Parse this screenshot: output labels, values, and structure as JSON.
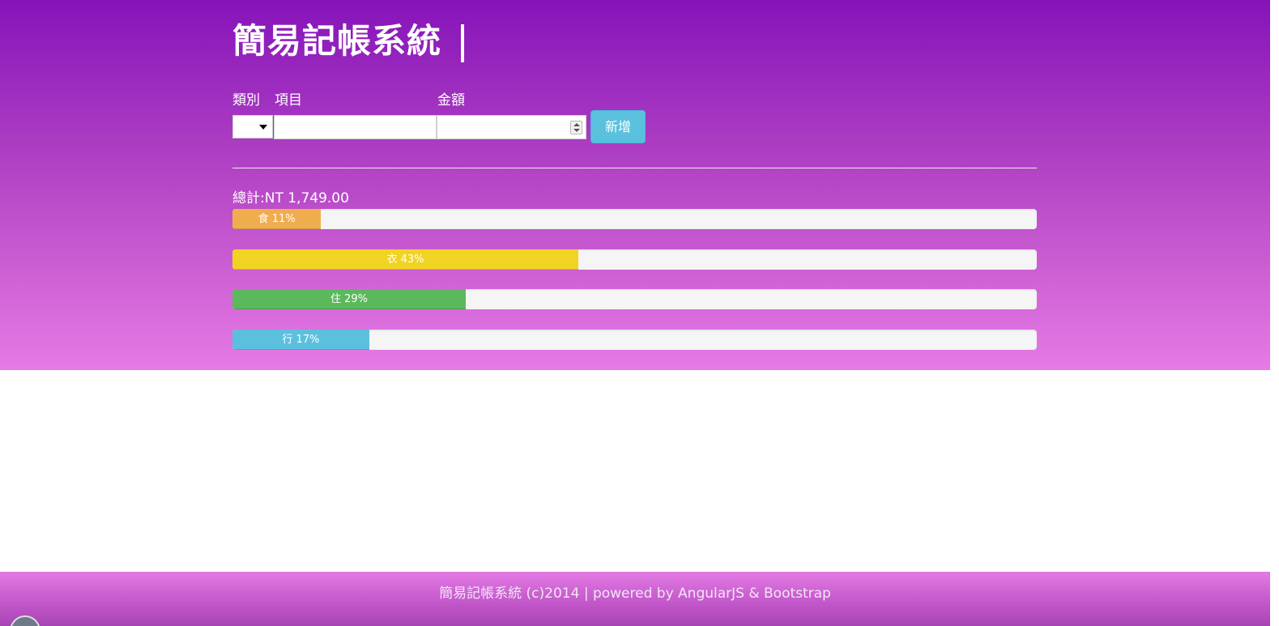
{
  "header": {
    "title": "簡易記帳系統"
  },
  "form": {
    "category_label": "類別",
    "item_label": "項目",
    "amount_label": "金額",
    "category_value": "",
    "item_value": "",
    "amount_value": "",
    "add_button_label": "新增"
  },
  "summary": {
    "total_text": "總計:NT 1,749.00"
  },
  "progress_bars": [
    {
      "label": "食 11%",
      "percent": 11,
      "color": "#f0ad4e"
    },
    {
      "label": "衣 43%",
      "percent": 43,
      "color": "#f1d423"
    },
    {
      "label": "住 29%",
      "percent": 29,
      "color": "#5cb85c"
    },
    {
      "label": "行 17%",
      "percent": 17,
      "color": "#5bc0de"
    }
  ],
  "footer": {
    "text": "簡易記帳系統 (c)2014 | powered by AngularJS & Bootstrap"
  },
  "colors": {
    "accent": "#5bc0de",
    "hero_top": "#8613b9",
    "hero_bottom": "#e57be6"
  }
}
